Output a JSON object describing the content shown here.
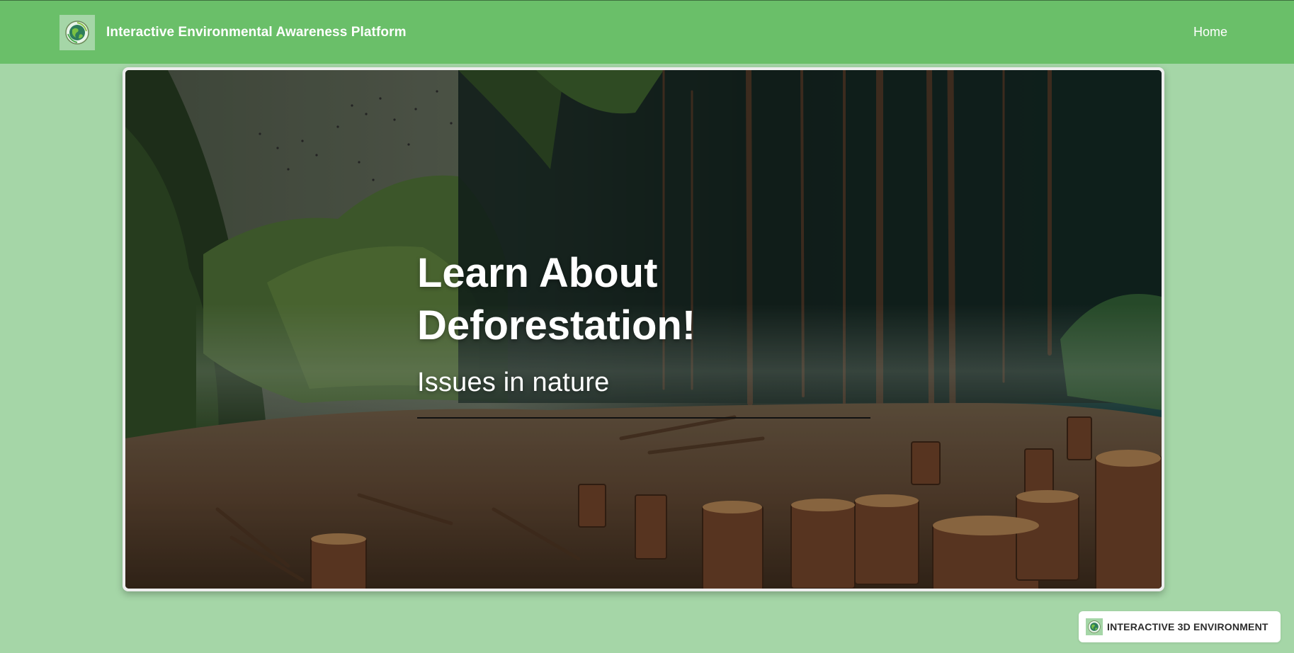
{
  "navbar": {
    "brand_title": "Interactive Environmental Awareness Platform",
    "logo_icon": "earth-globe-icon",
    "home_label": "Home",
    "background": "#6abf69"
  },
  "hero": {
    "title": "Learn About Deforestation!",
    "subtitle": "Issues in nature",
    "background_image": "deforested-forest-with-tree-stumps"
  },
  "floating_button": {
    "label": "INTERACTIVE 3D ENVIRONMENT",
    "icon": "earth-globe-icon"
  },
  "colors": {
    "page_background": "#a5d6a7",
    "navbar": "#6abf69",
    "text_light": "#ffffff"
  }
}
